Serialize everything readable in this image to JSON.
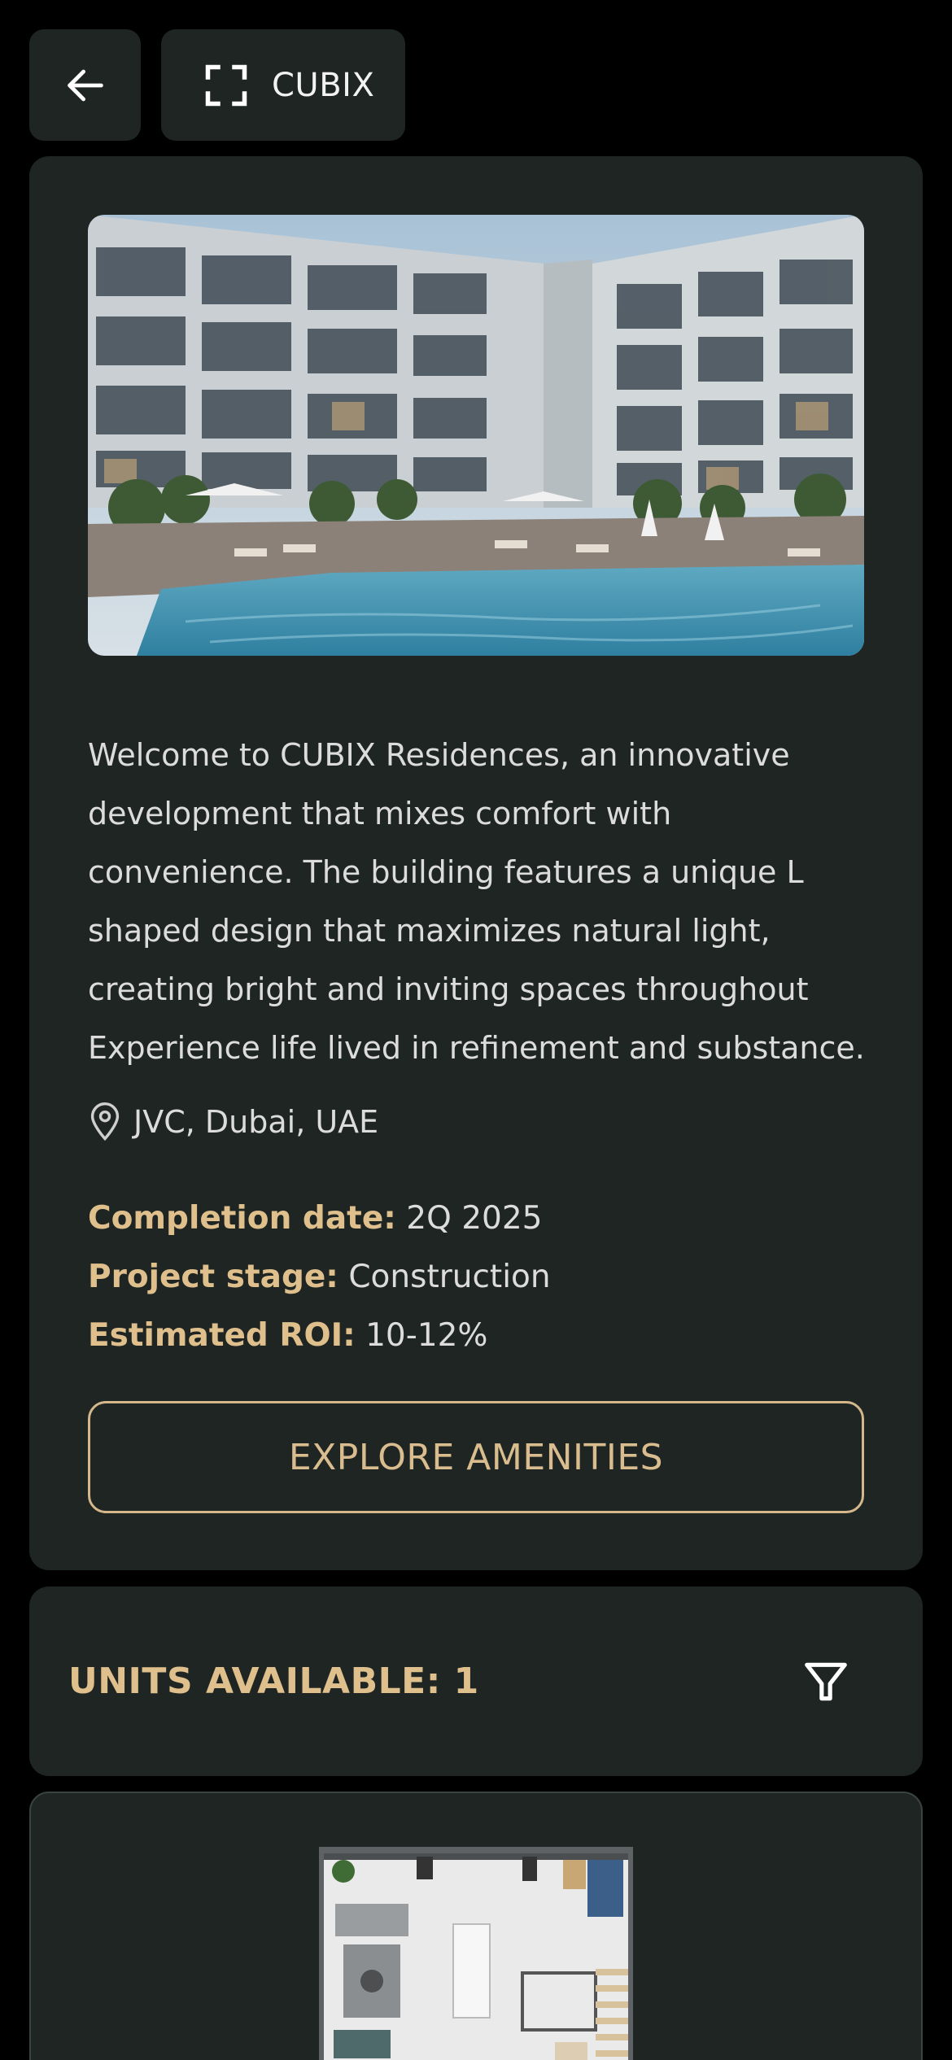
{
  "header": {
    "project_name": "CUBIX"
  },
  "info": {
    "description": "Welcome to CUBIX Residences, an innovative development that mixes comfort with convenience. The building features a unique L shaped design that maximizes natural light, creating bright and inviting spaces throughout Experience life lived in refinement and substance.",
    "location": "JVC, Dubai, UAE",
    "facts": [
      {
        "label": "Completion date:",
        "value": "2Q 2025"
      },
      {
        "label": "Project stage:",
        "value": "Construction"
      },
      {
        "label": "Estimated ROI:",
        "value": "10-12%"
      }
    ],
    "amenities_button": "EXPLORE AMENITIES"
  },
  "units": {
    "title": "UNITS AVAILABLE: 1"
  },
  "colors": {
    "background": "#000000",
    "card": "#1e2523",
    "accent_gold": "#dfc08d",
    "text": "#dcdcdc"
  },
  "icons": {
    "back": "arrow-left-icon",
    "project": "scan-frame-icon",
    "location": "map-pin-icon",
    "filter": "filter-funnel-icon"
  }
}
